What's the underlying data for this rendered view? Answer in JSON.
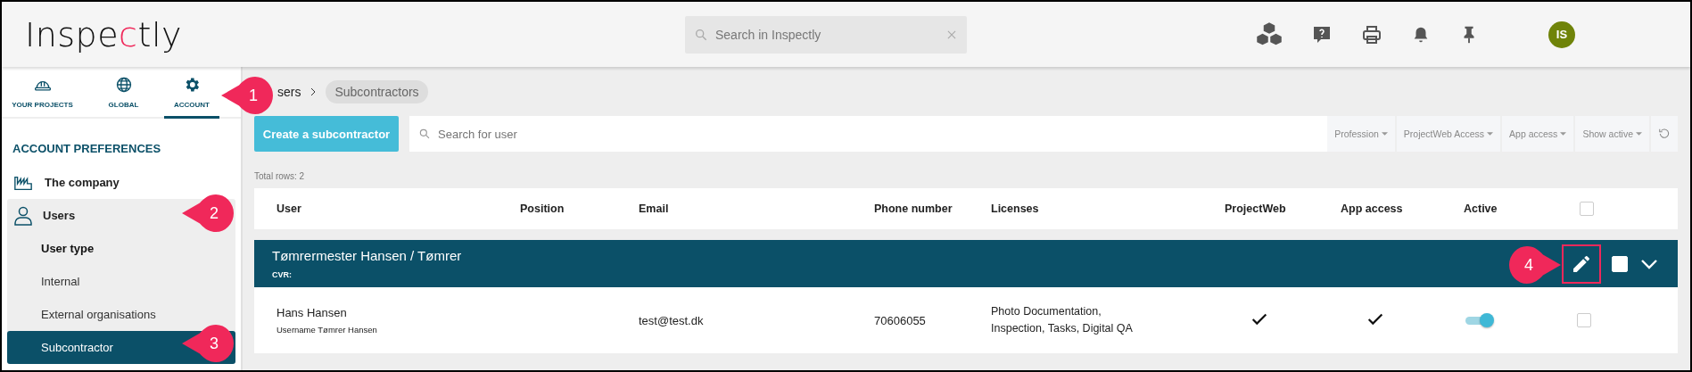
{
  "logo": {
    "text": "Inspectly"
  },
  "search": {
    "placeholder": "Search in Inspectly"
  },
  "avatar": {
    "initials": "IS"
  },
  "nav_tabs": [
    {
      "label": "YOUR PROJECTS",
      "selected": false
    },
    {
      "label": "GLOBAL",
      "selected": false
    },
    {
      "label": "ACCOUNT",
      "selected": true
    }
  ],
  "sidebar": {
    "heading": "ACCOUNT PREFERENCES",
    "items": [
      {
        "label": "The company",
        "expanded": false
      },
      {
        "label": "Users",
        "expanded": true,
        "children": [
          {
            "kind": "heading",
            "label": "User type",
            "selected": false
          },
          {
            "kind": "link",
            "label": "Internal",
            "selected": false
          },
          {
            "kind": "link",
            "label": "External organisations",
            "selected": false
          },
          {
            "kind": "link",
            "label": "Subcontractor",
            "selected": true
          }
        ]
      }
    ]
  },
  "breadcrumb": [
    "sers",
    "Subcontractors"
  ],
  "toolbar": {
    "create_button": "Create a subcontractor",
    "search_placeholder": "Search for user",
    "filters": [
      "Profession",
      "ProjectWeb Access",
      "App access",
      "Show active"
    ]
  },
  "total_rows": "Total rows: 2",
  "table": {
    "columns": [
      "User",
      "Position",
      "Email",
      "Phone number",
      "Licenses",
      "ProjectWeb",
      "App access",
      "Active"
    ],
    "select_all_checked": false,
    "groups": [
      {
        "title": "Tømrermester Hansen / Tømrer",
        "subtitle": "CVR:",
        "checked": false,
        "rows": [
          {
            "name": "Hans Hansen",
            "username": "Username Tømrer Hansen",
            "email": "test@test.dk",
            "phone": "70606055",
            "licenses": "Photo Documentation,\nInspection, Tasks, Digital QA",
            "projectweb": true,
            "app_access": true,
            "active": true,
            "checked": false
          }
        ]
      }
    ]
  },
  "callouts": [
    {
      "number": "1"
    },
    {
      "number": "2"
    },
    {
      "number": "3"
    },
    {
      "number": "4"
    }
  ]
}
